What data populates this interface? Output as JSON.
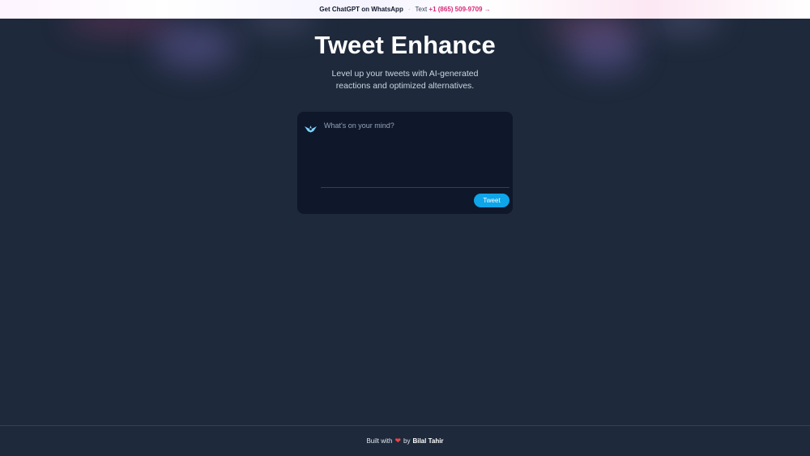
{
  "banner": {
    "lead": "Get ChatGPT on WhatsApp",
    "separator": "·",
    "text_label": "Text",
    "phone": "+1 (865) 509-9709 →"
  },
  "hero": {
    "title": "Tweet Enhance",
    "subtitle": "Level up your tweets with AI-generated reactions and optimized alternatives."
  },
  "composer": {
    "placeholder": "What's on your mind?",
    "value": "",
    "button_label": "Tweet",
    "avatar_icon": "bird-avatar-icon"
  },
  "footer": {
    "prefix": "Built with",
    "heart": "❤",
    "by": "by",
    "author": "Bilal Tahir"
  },
  "colors": {
    "background": "#1e293b",
    "card": "#0f172a",
    "accent": "#0ea5e9",
    "phone_link": "#db2777",
    "heart": "#ef4444"
  }
}
